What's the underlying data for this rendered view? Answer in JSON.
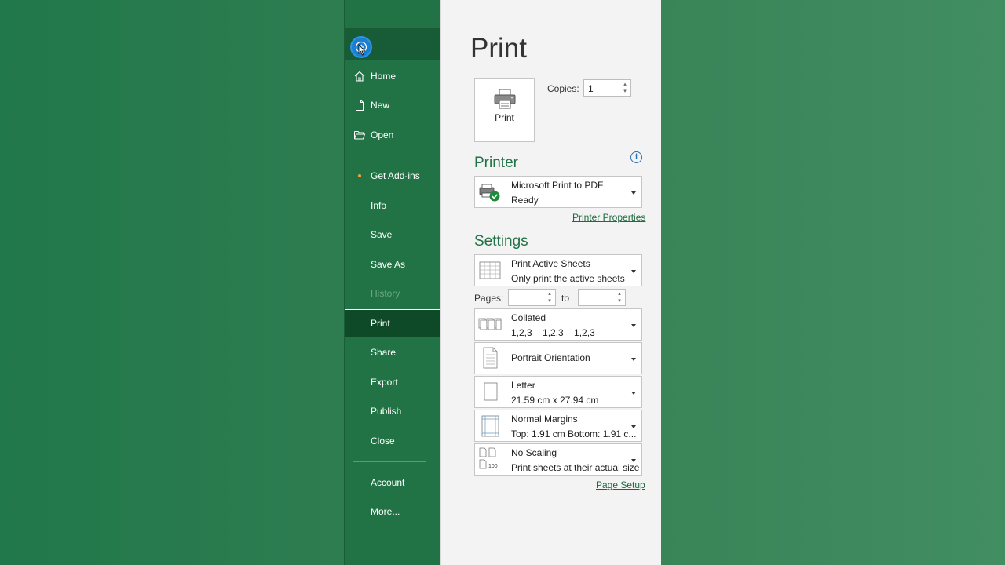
{
  "nav": {
    "items": [
      {
        "label": "Home",
        "icon": "home-icon"
      },
      {
        "label": "New",
        "icon": "new-document-icon"
      },
      {
        "label": "Open",
        "icon": "open-folder-icon"
      },
      {
        "label": "Get Add-ins"
      },
      {
        "label": "Info"
      },
      {
        "label": "Save"
      },
      {
        "label": "Save As"
      },
      {
        "label": "History"
      },
      {
        "label": "Print"
      },
      {
        "label": "Share"
      },
      {
        "label": "Export"
      },
      {
        "label": "Publish"
      },
      {
        "label": "Close"
      },
      {
        "label": "Account"
      },
      {
        "label": "More..."
      }
    ],
    "selected": "Print",
    "disabled": "History"
  },
  "content": {
    "title": "Print",
    "print_button_label": "Print",
    "copies_label": "Copies:",
    "copies_value": "1",
    "printer_heading": "Printer",
    "printer": {
      "name": "Microsoft Print to PDF",
      "status": "Ready"
    },
    "printer_properties_link": "Printer Properties",
    "settings_heading": "Settings",
    "active_sheets": {
      "title": "Print Active Sheets",
      "desc": "Only print the active sheets"
    },
    "pages_label": "Pages:",
    "pages_from": "",
    "to_label": "to",
    "pages_to": "",
    "collated": {
      "title": "Collated",
      "desc": "1,2,3    1,2,3    1,2,3"
    },
    "orientation": {
      "title": "Portrait Orientation"
    },
    "paper": {
      "title": "Letter",
      "desc": "21.59 cm x 27.94 cm"
    },
    "margins": {
      "title": "Normal Margins",
      "desc": "Top: 1.91 cm Bottom: 1.91 c..."
    },
    "scaling": {
      "title": "No Scaling",
      "desc": "Print sheets at their actual size"
    },
    "page_setup_link": "Page Setup"
  },
  "colors": {
    "excel_green": "#217346",
    "nav_selected": "#0e4a28",
    "heading_green": "#217346",
    "back_button_blue": "#1a7fd1"
  }
}
